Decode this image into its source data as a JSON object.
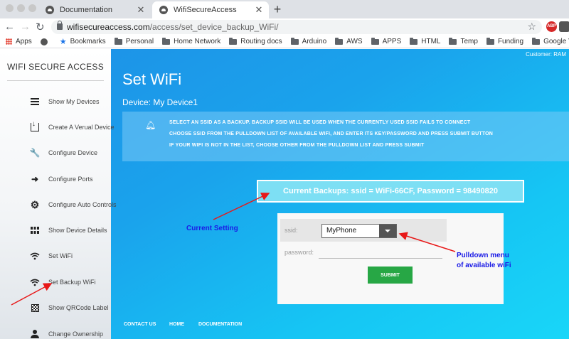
{
  "browser": {
    "tabs": [
      {
        "label": "Documentation",
        "active": false
      },
      {
        "label": "WifiSecureAccess",
        "active": true
      }
    ],
    "new_tab": "+",
    "url_host": "wifisecureaccess.com",
    "url_path": "/access/set_device_backup_WiFi/",
    "bookmarks": [
      "Apps",
      "Bookmarks",
      "Personal",
      "Home Network",
      "Routing docs",
      "Arduino",
      "AWS",
      "APPS",
      "HTML",
      "Temp",
      "Funding",
      "Google VPS"
    ],
    "extensions": {
      "abp": "ABP"
    }
  },
  "header": {
    "customer": "Customer: RAM"
  },
  "sidebar": {
    "brand": "WIFI SECURE ACCESS",
    "items": [
      {
        "label": "Show My Devices",
        "icon": "list-icon"
      },
      {
        "label": "Create A Verual Device",
        "icon": "download-icon"
      },
      {
        "label": "Configure Device",
        "icon": "wrench-icon"
      },
      {
        "label": "Configure Ports",
        "icon": "arrow-right-icon"
      },
      {
        "label": "Configure Auto Controls",
        "icon": "gear-icon"
      },
      {
        "label": "Show Device Details",
        "icon": "grid-icon"
      },
      {
        "label": "Set WiFi",
        "icon": "wifi-icon"
      },
      {
        "label": "Set Backup WiFi",
        "icon": "wifi-icon"
      },
      {
        "label": "Show QRCode Label",
        "icon": "qrcode-icon"
      },
      {
        "label": "Change Ownership",
        "icon": "person-icon"
      }
    ]
  },
  "main": {
    "title": "Set WiFi",
    "subtitle": "Device: My Device1",
    "info_lines": [
      "SELECT AN SSID AS A BACKUP. BACKUP SSID WILL BE USED WHEN THE CURRENTLY USED SSID FAILS TO CONNECT",
      "CHOOSE SSID FROM THE PULLDOWN LIST OF AVAILABLE WIFI, AND ENTER ITS KEY/PASSWORD AND PRESS SUBMIT BUTTON",
      "IF YOUR WIFI IS NOT IN THE LIST, CHOOSE OTHER FROM THE PULLDOWN LIST AND PRESS SUBMIT"
    ],
    "current_backups": "Current Backups: ssid = WiFi-66CF, Password = 98490820",
    "form": {
      "ssid_label": "ssid:",
      "ssid_value": "MyPhone",
      "password_label": "password:",
      "password_value": "",
      "submit_label": "SUBMIT"
    },
    "annotations": {
      "current_setting": "Current Setting",
      "pulldown_line1": "Pulldown menu",
      "pulldown_line2": "of available wiFi"
    }
  },
  "footer": {
    "links": [
      "CONTACT US",
      "HOME",
      "DOCUMENTATION"
    ]
  },
  "colors": {
    "accent": "#1aa3ec",
    "submit": "#27a745",
    "annotation": "#1a1ae6",
    "arrow": "#e81818"
  }
}
